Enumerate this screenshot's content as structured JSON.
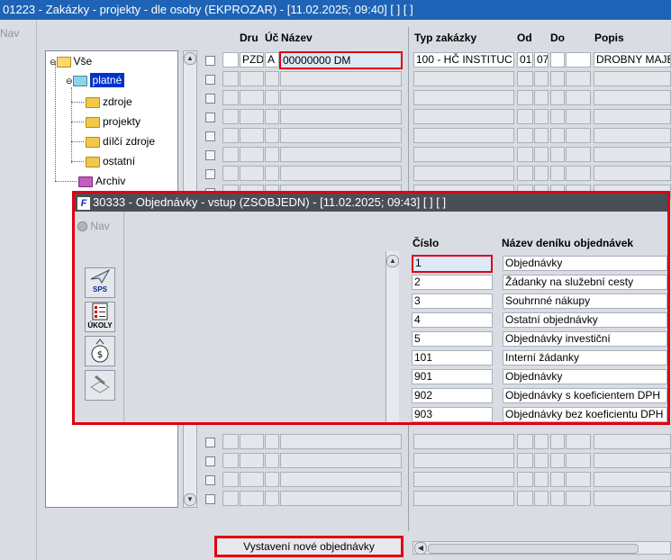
{
  "window": {
    "title": "01223 - Zakázky - projekty - dle osoby (EKPROZAR) - [11.02.2025; 09:40]  [ ]  [ ]"
  },
  "nav_label": "Nav",
  "tree": {
    "root": "Vše",
    "selected": "platné",
    "children": [
      "zdroje",
      "projekty",
      "dílčí zdroje",
      "ostatní"
    ],
    "archive": "Archiv"
  },
  "grid": {
    "headers": {
      "dru": "Dru",
      "uc": "Úč",
      "nazev": "Název",
      "typ": "Typ zakázky",
      "od": "Od",
      "do": "Do",
      "popis": "Popis"
    },
    "first_row": {
      "dru": "PZD",
      "uc": "A",
      "nazev": "00000000 DM",
      "typ": "100 - HČ INSTITUC",
      "od": "01",
      "do": "07",
      "popis": "DROBNY MAJE"
    }
  },
  "dialog": {
    "title": "30333 - Objednávky - vstup (ZSOBJEDN) - [11.02.2025; 09:43]  [ ]  [ ]",
    "logo": "F",
    "nav_label": "Nav",
    "toolbar": {
      "sps_label": "SPS",
      "ukoly_label": "ÚKOLY"
    },
    "headers": {
      "cislo": "Číslo",
      "nazev": "Název deníku objednávek"
    },
    "rows": [
      {
        "cislo": "1",
        "nazev": "Objednávky"
      },
      {
        "cislo": "2",
        "nazev": "Žádanky na služební cesty"
      },
      {
        "cislo": "3",
        "nazev": "Souhrnné nákupy"
      },
      {
        "cislo": "4",
        "nazev": "Ostatní objednávky"
      },
      {
        "cislo": "5",
        "nazev": "Objednávky investiční"
      },
      {
        "cislo": "101",
        "nazev": "Interní žádanky"
      },
      {
        "cislo": "901",
        "nazev": "Objednávky"
      },
      {
        "cislo": "902",
        "nazev": "Objednávky s koeficientem DPH"
      },
      {
        "cislo": "903",
        "nazev": "Objednávky bez koeficientu DPH"
      }
    ]
  },
  "bottom_button": "Vystavení nové objednávky"
}
